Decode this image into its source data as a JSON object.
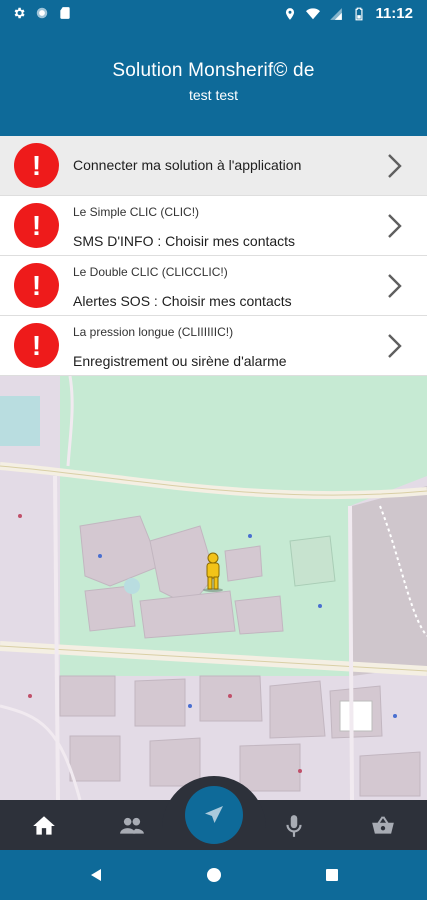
{
  "status_bar": {
    "time": "11:12",
    "left_icons": [
      "gear-icon",
      "sync-icon",
      "sd-card-icon"
    ],
    "right_icons": [
      "location-icon",
      "wifi-icon",
      "signal-icon",
      "battery-icon"
    ]
  },
  "header": {
    "title": "Solution Monsherif© de",
    "subtitle": "test test"
  },
  "list": {
    "items": [
      {
        "sub": "",
        "main": "Connecter ma solution à l'application",
        "alert_symbol": "!"
      },
      {
        "sub": "Le Simple CLIC (CLIC!)",
        "main": "SMS D'INFO : Choisir mes contacts",
        "alert_symbol": "!"
      },
      {
        "sub": "Le Double CLIC (CLICCLIC!)",
        "main": "Alertes SOS : Choisir mes contacts",
        "alert_symbol": "!"
      },
      {
        "sub": "La pression longue (CLIIIIIIC!)",
        "main": "Enregistrement ou sirène d'alarme",
        "alert_symbol": "!"
      }
    ]
  },
  "bottom_nav": {
    "items": [
      "home-icon",
      "people-icon",
      "navigation-icon",
      "microphone-icon",
      "basket-icon"
    ],
    "active": "home-icon"
  },
  "system_nav": [
    "back-icon",
    "home-circle-icon",
    "recents-icon"
  ],
  "colors": {
    "primary": "#0e6a99",
    "alert": "#ee1b1b",
    "nav_bar": "#2d313a",
    "first_item_bg": "#ececec",
    "map_park": "#c6ead3",
    "map_base": "#e3dbe6"
  }
}
